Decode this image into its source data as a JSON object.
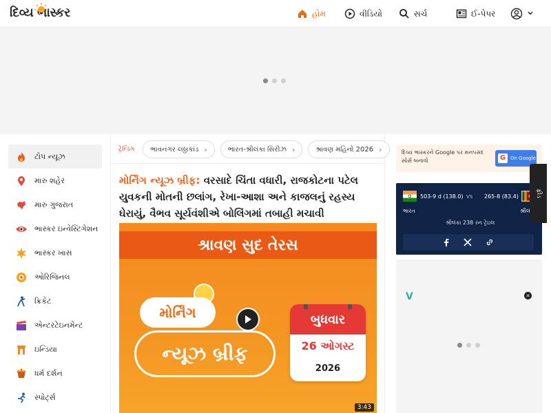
{
  "header": {
    "logo_text": "દિવ્ય ભાસ્કર",
    "nav": {
      "home": "હોમ",
      "video": "વીડિયો",
      "search": "સર્ચ",
      "epaper": "ઈ-પેપર"
    }
  },
  "sidebar": {
    "items": [
      {
        "label": "ટોપ ન્યૂઝ",
        "icon": "flame-icon"
      },
      {
        "label": "મારું શહેર",
        "icon": "location-pin-icon"
      },
      {
        "label": "મારું ગુજરાત",
        "icon": "gujarat-map-icon"
      },
      {
        "label": "ભાસ્કર ઇન્વેસ્ટિગેશન",
        "icon": "eye-icon"
      },
      {
        "label": "ભાસ્કર ખાસ",
        "icon": "star-icon"
      },
      {
        "label": "ઓરિજિનલ",
        "icon": "original-icon"
      },
      {
        "label": "ક્રિકેટ",
        "icon": "cricket-icon"
      },
      {
        "label": "એન્ટરટેઇનમેન્ટ",
        "icon": "clapperboard-icon"
      },
      {
        "label": "ઇન્ડિયા",
        "icon": "india-gate-icon"
      },
      {
        "label": "ધર્મ દર્શન",
        "icon": "drum-icon"
      },
      {
        "label": "સ્પોર્ટ્સ",
        "icon": "running-icon"
      }
    ]
  },
  "trending": {
    "label": "ટ્રેન્ડિંગ",
    "chips": [
      "ભાવનગર લઠ્ઠાકાંડ",
      "ભારત-શ્રીલંકા સિરીઝ",
      "શ્રાવણ મહિનો 2026"
    ]
  },
  "headline": {
    "kicker": "મોર્નિંગ ન્યૂઝ બ્રીફ:",
    "text": "વરસાદે ચિંતા વધારી, રાજકોટના પટેલ યુવકની મોતની છલાંગ, રેખા-આશા અને કાજલનું રહસ્ય ઘેરાયું, વૈભવ સૂર્યવંશીએ બોલિંગમાં તબાહી મચાવી"
  },
  "hero": {
    "banner": "શ્રાવણ સુદ તેરસ",
    "cloud_text": "મોર્નિંગ",
    "title": "ન્યૂઝ બ્રીફ",
    "day": "બુધવાર",
    "date": "26 ઓગસ્ટ",
    "year": "2026",
    "duration": "3:43"
  },
  "google_box": {
    "text": "દિવ્ય ભાસ્કરને Google પર મનપસંદ સોર્સ બનાવો",
    "button": "On Google"
  },
  "score": {
    "team1_score": "503-9 d (138.0)",
    "team2_score": "265-8 (83.4)",
    "vs": "VS",
    "team1": "ભારત",
    "team2": "શ્રીલંકા",
    "status": "શ્રીલંકા 238 રન ટ્રેઇલ"
  },
  "side_tab": "ફીડ",
  "ad_logo": "V",
  "colors": {
    "accent": "#ea6b0e",
    "score_bg": "#0f2347",
    "trend_red": "#e23b2d"
  }
}
